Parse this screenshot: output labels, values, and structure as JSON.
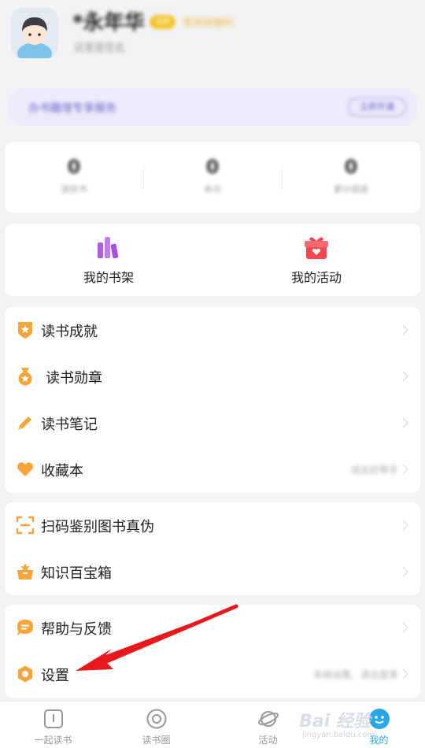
{
  "profile": {
    "username": "*永年华",
    "badge": "VIP",
    "badge_text": "签到领福利",
    "signature": "这里是签名"
  },
  "vip_banner": {
    "text": "办书籍增专享服务",
    "button": "立即开通"
  },
  "stats": [
    {
      "value": "0",
      "label": "读完书"
    },
    {
      "value": "0",
      "label": "本月"
    },
    {
      "value": "0",
      "label": "累计阅读"
    }
  ],
  "quick": {
    "bookshelf": "我的书架",
    "activity": "我的活动"
  },
  "menu1": [
    {
      "label": "读书成就",
      "icon": "trophy-icon"
    },
    {
      "label": "读书勋章",
      "icon": "medal-icon"
    },
    {
      "label": "读书笔记",
      "icon": "pencil-icon"
    },
    {
      "label": "收藏本",
      "icon": "heart-icon",
      "value": "成长好帮手"
    }
  ],
  "menu2": [
    {
      "label": "扫码鉴别图书真伪",
      "icon": "scan-icon"
    },
    {
      "label": "知识百宝箱",
      "icon": "treasure-box-icon"
    }
  ],
  "menu3": [
    {
      "label": "帮助与反馈",
      "icon": "chat-icon"
    },
    {
      "label": "设置",
      "icon": "gear-icon",
      "value": "系统设置、退出登录"
    }
  ],
  "tabs": [
    {
      "label": "一起读书",
      "icon": "book-icon"
    },
    {
      "label": "读书圈",
      "icon": "circle-icon"
    },
    {
      "label": "活动",
      "icon": "planet-icon"
    },
    {
      "label": "我的",
      "icon": "profile-icon",
      "active": true
    }
  ],
  "watermark": {
    "main": "Bai 经验",
    "sub": "jingyan.baidu.com"
  },
  "colors": {
    "accent": "#2aa6e8",
    "orange": "#f7a43a",
    "purple": "#b05ce6",
    "red": "#f0484e",
    "arrow": "#e8181c"
  }
}
